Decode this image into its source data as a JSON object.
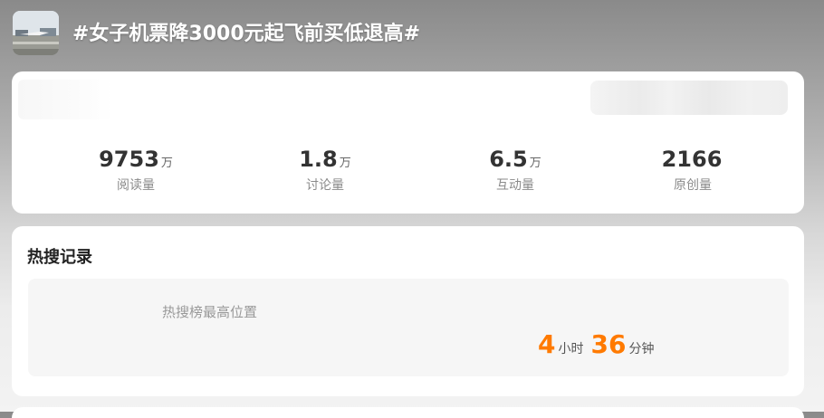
{
  "topic": {
    "title": "#女子机票降3000元起飞前买低退高#"
  },
  "stats": [
    {
      "value": "9753",
      "unit": "万",
      "label": "阅读量"
    },
    {
      "value": "1.8",
      "unit": "万",
      "label": "讨论量"
    },
    {
      "value": "6.5",
      "unit": "万",
      "label": "互动量"
    },
    {
      "value": "2166",
      "unit": "",
      "label": "原创量"
    }
  ],
  "hot_search": {
    "title": "热搜记录",
    "label": "热搜榜最高位置",
    "duration_hours": "4",
    "hours_unit": "小时",
    "duration_minutes": "36",
    "minutes_unit": "分钟"
  },
  "colors": {
    "accent": "#ff7a00",
    "card_bg": "#ffffff",
    "panel_bg": "#f6f6f6"
  }
}
